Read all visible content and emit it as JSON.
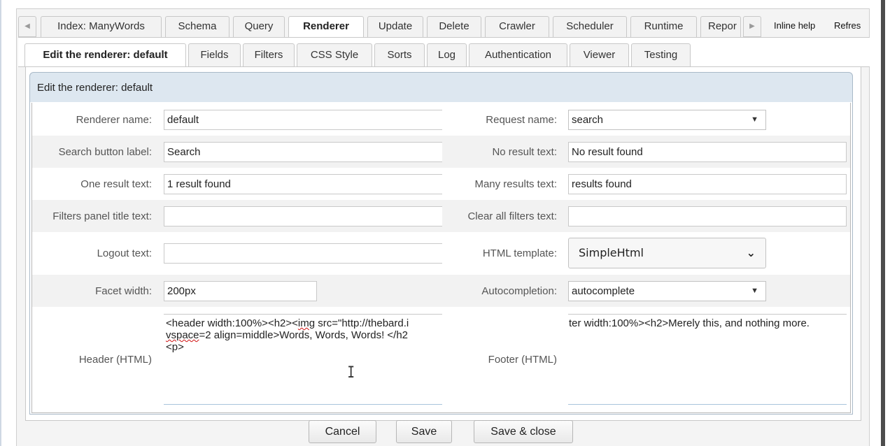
{
  "top_tabs": [
    {
      "label": "Index: ManyWords",
      "active": false
    },
    {
      "label": "Schema",
      "active": false
    },
    {
      "label": "Query",
      "active": false
    },
    {
      "label": "Renderer",
      "active": true
    },
    {
      "label": "Update",
      "active": false
    },
    {
      "label": "Delete",
      "active": false
    },
    {
      "label": "Crawler",
      "active": false
    },
    {
      "label": "Scheduler",
      "active": false
    },
    {
      "label": "Runtime",
      "active": false
    },
    {
      "label": "Repor",
      "active": false
    }
  ],
  "top_links": {
    "inline_help": "Inline help",
    "refresh": "Refres"
  },
  "sub_tabs": [
    {
      "label": "Edit the renderer: default",
      "active": true
    },
    {
      "label": "Fields",
      "active": false
    },
    {
      "label": "Filters",
      "active": false
    },
    {
      "label": "CSS Style",
      "active": false
    },
    {
      "label": "Sorts",
      "active": false
    },
    {
      "label": "Log",
      "active": false
    },
    {
      "label": "Authentication",
      "active": false
    },
    {
      "label": "Viewer",
      "active": false
    },
    {
      "label": "Testing",
      "active": false
    }
  ],
  "panel": {
    "title": "Edit the renderer: default"
  },
  "form": {
    "renderer_name": {
      "label": "Renderer name:",
      "value": "default"
    },
    "request_name": {
      "label": "Request name:",
      "value": "search"
    },
    "search_button_label": {
      "label": "Search button label:",
      "value": "Search"
    },
    "no_result_text": {
      "label": "No result text:",
      "value": "No result found"
    },
    "one_result_text": {
      "label": "One result text:",
      "value": "1 result found"
    },
    "many_results_text": {
      "label": "Many results text:",
      "value": "results found"
    },
    "filters_panel_title_text": {
      "label": "Filters panel title text:",
      "value": ""
    },
    "clear_all_filters_text": {
      "label": "Clear all filters text:",
      "value": ""
    },
    "logout_text": {
      "label": "Logout text:",
      "value": ""
    },
    "html_template": {
      "label": "HTML template:",
      "value": "SimpleHtml"
    },
    "facet_width": {
      "label": "Facet width:",
      "value": "200px"
    },
    "autocompletion": {
      "label": "Autocompletion:",
      "value": "autocomplete"
    },
    "header_html": {
      "label": "Header (HTML)",
      "line1_a": "<header width:100%><h2><",
      "line1_b": "img",
      "line1_c": " src=\"http://thebard.i",
      "line2_a": "vspace",
      "line2_b": "=2 align=middle>Words, Words, Words! </h2",
      "line3": "<p>"
    },
    "footer_html": {
      "label": "Footer (HTML)",
      "line1": "ter width:100%><h2>Merely this, and nothing more."
    }
  },
  "buttons": {
    "cancel": "Cancel",
    "save": "Save",
    "save_close": "Save & close"
  },
  "icons": {
    "dropdown": "▼",
    "chevron": "⌄",
    "scroll_left": "◀",
    "scroll_right": "▶",
    "ibeam": "I"
  },
  "colors": {
    "panel_header_bg": "#dde7f0",
    "alt_row_bg": "#f2f2f2",
    "scrollbar": "#4d4d4d"
  }
}
